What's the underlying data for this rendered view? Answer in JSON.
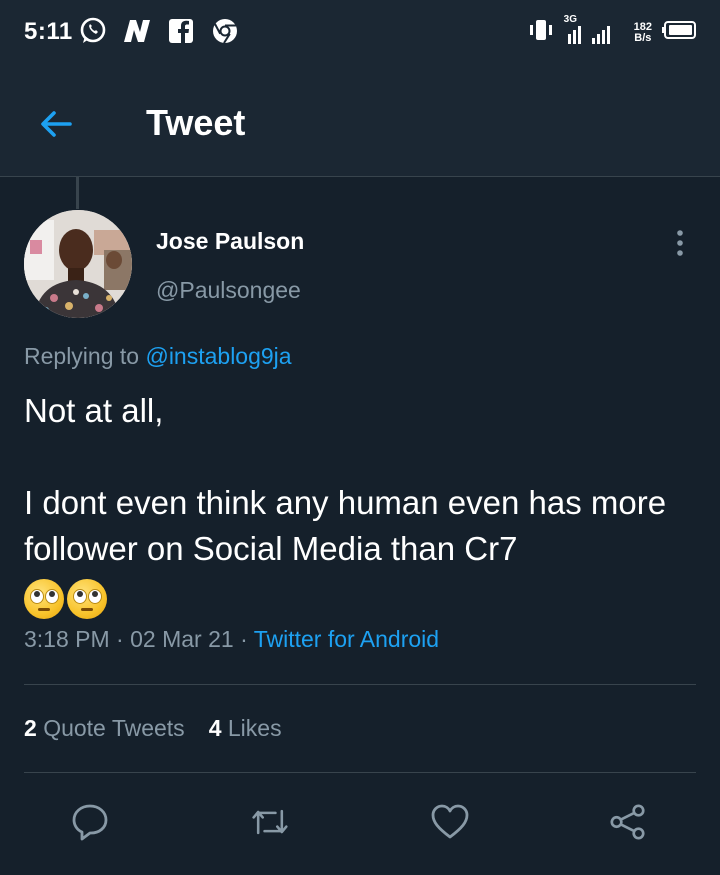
{
  "status_bar": {
    "time": "5:11",
    "net_type": "3G",
    "speed_value": "182",
    "speed_unit": "B/s",
    "icons": [
      "whatsapp-icon",
      "n-app-icon",
      "facebook-icon",
      "chrome-icon",
      "vibrate-icon",
      "signal-icon",
      "battery-icon"
    ]
  },
  "header": {
    "title": "Tweet",
    "back_icon": "back-arrow-icon"
  },
  "tweet": {
    "author_name": "Jose Paulson",
    "author_handle": "@Paulsongee",
    "replying_prefix": "Replying to",
    "replying_to": "@instablog9ja",
    "text_line1": "Not at all,",
    "text_line2": "I dont even think any human even has more follower on Social Media than Cr7",
    "emojis": [
      "face-with-rolling-eyes",
      "face-with-rolling-eyes"
    ],
    "time": "3:18 PM",
    "date": "02 Mar 21",
    "separator": "·",
    "source": "Twitter for Android"
  },
  "stats": {
    "quote_count": "2",
    "quote_label": "Quote Tweets",
    "like_count": "4",
    "like_label": "Likes"
  },
  "actions": [
    "reply-icon",
    "retweet-icon",
    "like-icon",
    "share-icon"
  ],
  "colors": {
    "background": "#15202b",
    "header_bg": "#1b2733",
    "accent": "#1da1f2",
    "secondary_text": "#8899a6",
    "divider": "#38444d"
  }
}
